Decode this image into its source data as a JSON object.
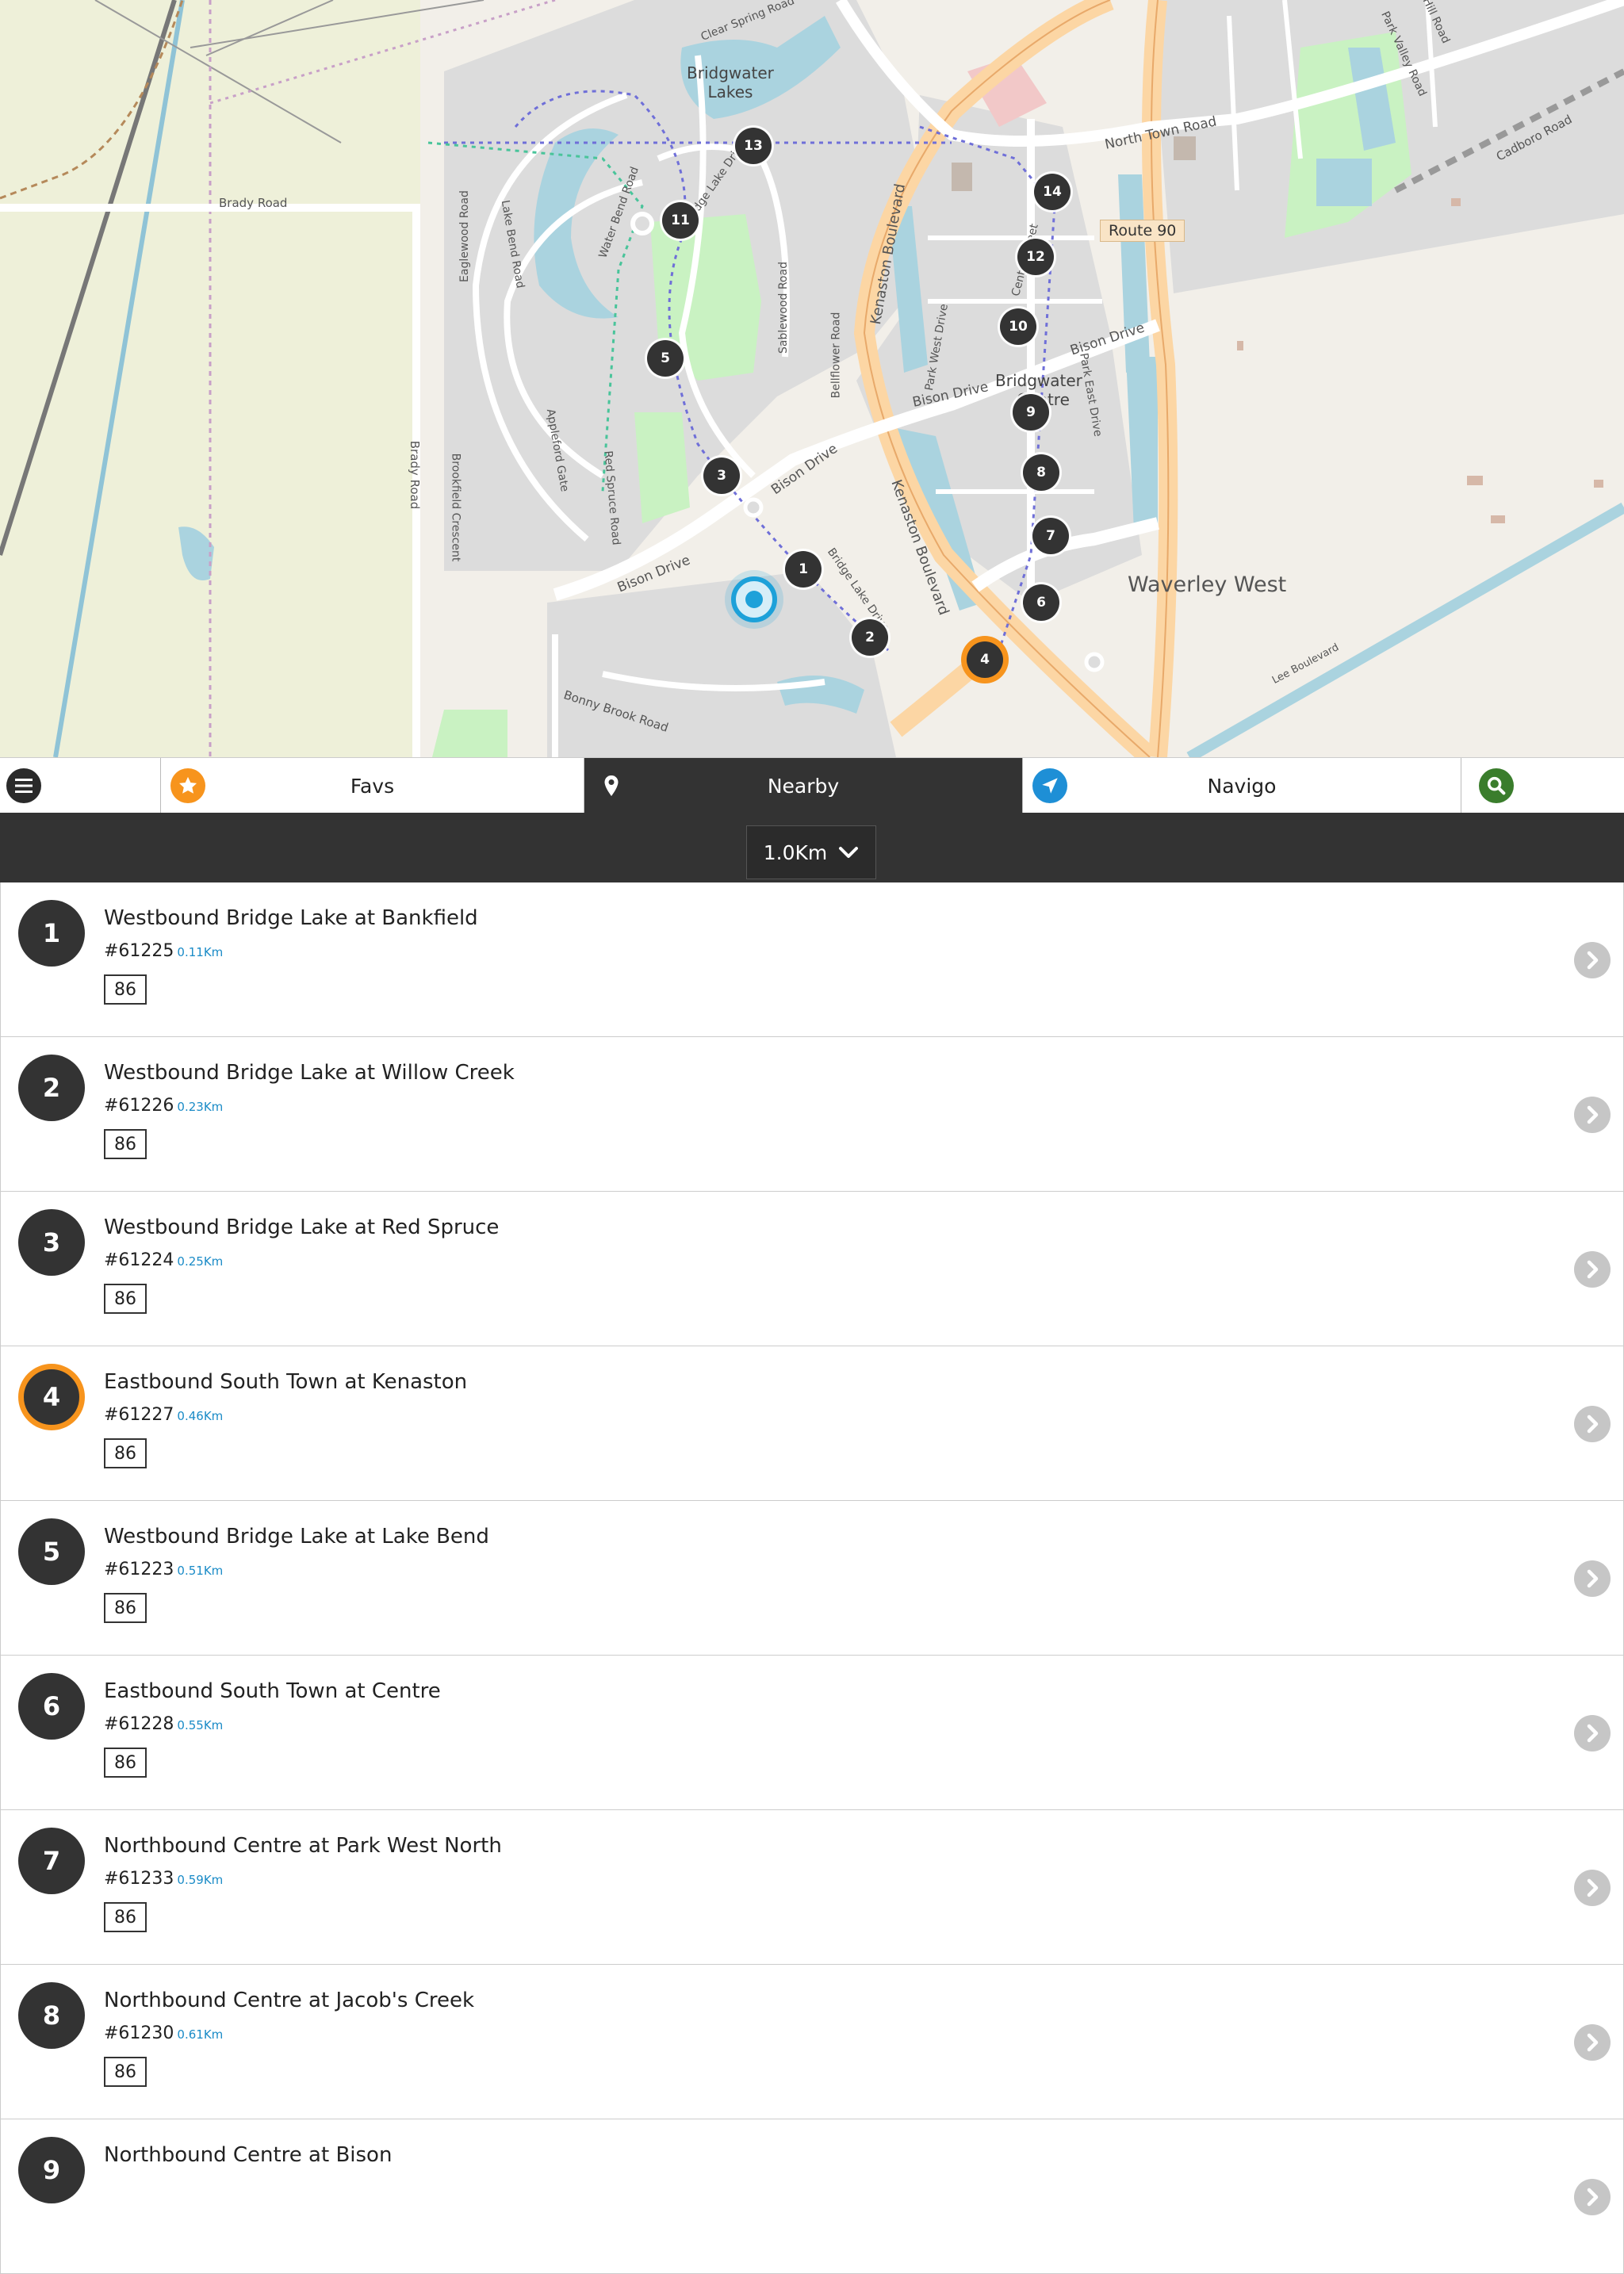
{
  "map": {
    "area_labels": {
      "bridgwater_lakes": "Bridgwater\nLakes",
      "bridgwater_centre_a": "Bridgwater",
      "bridgwater_centre_b": "Centre",
      "waverley_west": "Waverley West"
    },
    "road_labels": {
      "brady_road_top": "Brady Road",
      "brady_road_side": "Brady Road",
      "north_town_road": "North Town Road",
      "cadboro_road": "Cadboro Road",
      "route_90": "Route 90",
      "kenaston_blvd_upper": "Kenaston Boulevard",
      "kenaston_blvd_lower": "Kenaston Boulevard",
      "bison_drive_1": "Bison Drive",
      "bison_drive_2": "Bison Drive",
      "bison_drive_3": "Bison Drive",
      "bison_drive_4": "Bison Drive",
      "lake_bend_road": "Lake Bend Road",
      "eaglewood_road": "Eaglewood Road",
      "water_bend_road": "Water Bend Road",
      "sablewood_road": "Sablewood Road",
      "bellflower_road": "Bellflower Road",
      "appleford_gate": "Appleford Gate",
      "red_spruce_road": "Red Spruce Road",
      "brookfield_crescent": "Brookfield Crescent",
      "park_west_drive": "Park West Drive",
      "park_east_drive": "Park East Drive",
      "centre_street": "Centre Street",
      "bonny_brook_road": "Bonny Brook Road",
      "lee_boulevard": "Lee Boulevard",
      "clear_spring_road": "Clear Spring Road",
      "park_valley_road": "Park Valley Road",
      "hill_road": "Hill Road",
      "bridge_lake_drive_upper": "Bridge Lake Drive",
      "bridge_lake_drive_lower": "Bridge Lake Drive"
    },
    "markers": [
      "1",
      "2",
      "3",
      "4",
      "5",
      "6",
      "7",
      "8",
      "9",
      "10",
      "11",
      "12",
      "13",
      "14"
    ]
  },
  "tabs": {
    "favs": "Favs",
    "nearby": "Nearby",
    "navigo": "Navigo"
  },
  "distance": {
    "selected": "1.0Km"
  },
  "stops": [
    {
      "num": "1",
      "name": "Westbound Bridge Lake at Bankfield",
      "id": "#61225",
      "dist": "0.11Km",
      "route": "86",
      "highlight": false
    },
    {
      "num": "2",
      "name": "Westbound Bridge Lake at Willow Creek",
      "id": "#61226",
      "dist": "0.23Km",
      "route": "86",
      "highlight": false
    },
    {
      "num": "3",
      "name": "Westbound Bridge Lake at Red Spruce",
      "id": "#61224",
      "dist": "0.25Km",
      "route": "86",
      "highlight": false
    },
    {
      "num": "4",
      "name": "Eastbound South Town at Kenaston",
      "id": "#61227",
      "dist": "0.46Km",
      "route": "86",
      "highlight": true
    },
    {
      "num": "5",
      "name": "Westbound Bridge Lake at Lake Bend",
      "id": "#61223",
      "dist": "0.51Km",
      "route": "86",
      "highlight": false
    },
    {
      "num": "6",
      "name": "Eastbound South Town at Centre",
      "id": "#61228",
      "dist": "0.55Km",
      "route": "86",
      "highlight": false
    },
    {
      "num": "7",
      "name": "Northbound Centre at Park West North",
      "id": "#61233",
      "dist": "0.59Km",
      "route": "86",
      "highlight": false
    },
    {
      "num": "8",
      "name": "Northbound Centre at Jacob's Creek",
      "id": "#61230",
      "dist": "0.61Km",
      "route": "86",
      "highlight": false
    },
    {
      "num": "9",
      "name": "Northbound Centre at Bison",
      "id": "",
      "dist": "",
      "route": "",
      "highlight": false
    }
  ],
  "colors": {
    "accent_orange": "#f7941d",
    "dark_bar": "#333333",
    "distance_blue": "#1a8bc7",
    "location_blue": "#1ea1d9",
    "search_green": "#3a7d2c"
  },
  "icons": {
    "menu": "hamburger-menu-icon",
    "favs": "star-icon",
    "nearby": "map-pin-icon",
    "navigo": "navigation-arrow-icon",
    "search": "search-icon",
    "row_action": "chevron-right-icon",
    "dropdown": "chevron-down-icon"
  }
}
